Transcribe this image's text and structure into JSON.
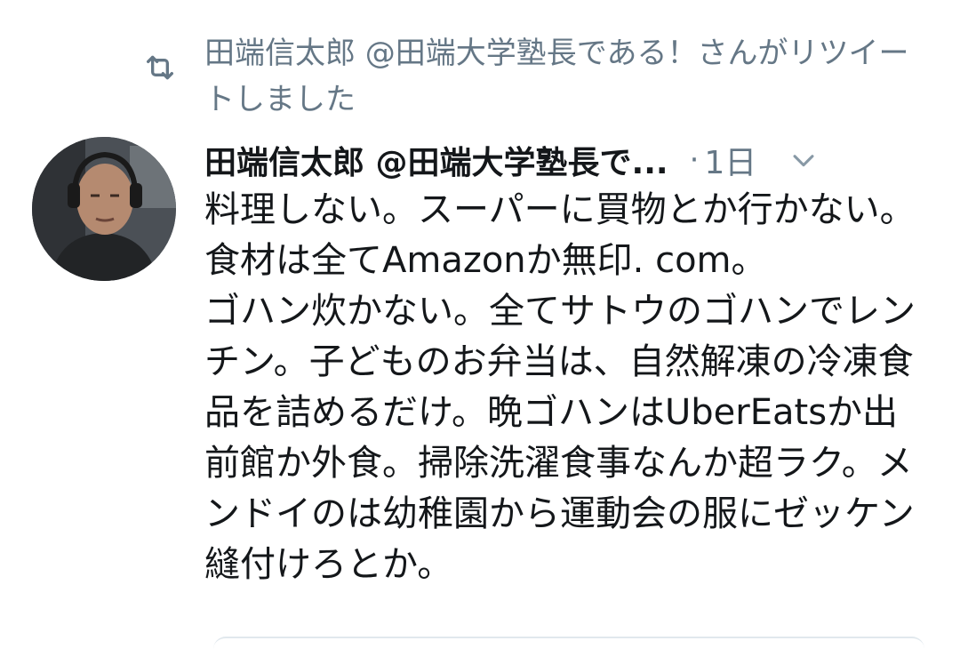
{
  "retweet": {
    "icon": "retweet-icon",
    "text": "田端信太郎 @田端大学塾長である！さんがリツイートしました"
  },
  "tweet": {
    "author": "田端信太郎 @田端大学塾長で...",
    "separator": "·",
    "time": "1日",
    "menu_icon": "chevron-down-icon",
    "body": "料理しない。スーパーに買物とか行かない。食材は全てAmazonか無印. com。\nゴハン炊かない。全てサトウのゴハンでレンチン。子どものお弁当は、自然解凍の冷凍食品を詰めるだけ。晩ゴハンはUberEatsか出前館か外食。掃除洗濯食事なんか超ラク。メンドイのは幼稚園から運動会の服にゼッケン縫付けろとか。"
  },
  "colors": {
    "text": "#14171a",
    "secondary": "#657786",
    "divider": "#e1e8ed"
  }
}
